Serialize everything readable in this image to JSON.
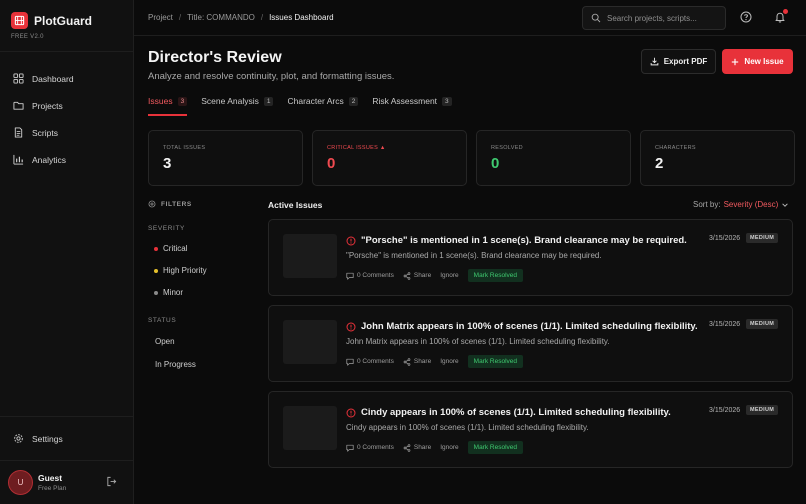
{
  "app": {
    "name": "PlotGuard",
    "version": "FREE V2.0"
  },
  "sidebar": {
    "items": [
      {
        "label": "Dashboard",
        "icon": "grid-icon"
      },
      {
        "label": "Projects",
        "icon": "folder-icon"
      },
      {
        "label": "Scripts",
        "icon": "file-icon"
      },
      {
        "label": "Analytics",
        "icon": "bar-chart-icon"
      }
    ],
    "settings_label": "Settings",
    "user": {
      "initial": "U",
      "name": "Guest",
      "plan": "Free Plan"
    }
  },
  "breadcrumb": [
    "Project",
    "Title: COMMANDO",
    "Issues Dashboard"
  ],
  "search": {
    "placeholder": "Search projects, scripts..."
  },
  "header": {
    "title": "Director's Review",
    "subtitle": "Analyze and resolve continuity, plot, and formatting issues.",
    "export_label": "Export PDF",
    "new_issue_label": "New Issue"
  },
  "tabs": [
    {
      "label": "Issues",
      "count": "3"
    },
    {
      "label": "Scene Analysis",
      "count": "1"
    },
    {
      "label": "Character Arcs",
      "count": "2"
    },
    {
      "label": "Risk Assessment",
      "count": "3"
    }
  ],
  "stats": [
    {
      "label": "TOTAL ISSUES",
      "value": "3",
      "color": "#f2f2f2"
    },
    {
      "label": "CRITICAL ISSUES ▲",
      "value": "0",
      "color": "#f04a50"
    },
    {
      "label": "RESOLVED",
      "value": "0",
      "color": "#3fca70"
    },
    {
      "label": "CHARACTERS",
      "value": "2",
      "color": "#f2f2f2"
    }
  ],
  "filters": {
    "title": "FILTERS",
    "severity_label": "SEVERITY",
    "severity": [
      {
        "label": "Critical",
        "color": "#e8323a"
      },
      {
        "label": "High Priority",
        "color": "#e6c02c"
      },
      {
        "label": "Minor",
        "color": "#8a8a8a"
      }
    ],
    "status_label": "STATUS",
    "status": [
      "Open",
      "In Progress"
    ]
  },
  "issues_section": {
    "title": "Active Issues",
    "sort_label": "Sort by:",
    "sort_value": "Severity (Desc)"
  },
  "issues": [
    {
      "title": "\"Porsche\" is mentioned in 1 scene(s). Brand clearance may be required.",
      "description": "\"Porsche\" is mentioned in 1 scene(s). Brand clearance may be required.",
      "date": "3/15/2026",
      "severity": "MEDIUM",
      "comments": "0 Comments",
      "share": "Share",
      "ignore": "Ignore",
      "resolve": "Mark Resolved"
    },
    {
      "title": "John Matrix appears in 100% of scenes (1/1). Limited scheduling flexibility.",
      "description": "John Matrix appears in 100% of scenes (1/1). Limited scheduling flexibility.",
      "date": "3/15/2026",
      "severity": "MEDIUM",
      "comments": "0 Comments",
      "share": "Share",
      "ignore": "Ignore",
      "resolve": "Mark Resolved"
    },
    {
      "title": "Cindy appears in 100% of scenes (1/1). Limited scheduling flexibility.",
      "description": "Cindy appears in 100% of scenes (1/1). Limited scheduling flexibility.",
      "date": "3/15/2026",
      "severity": "MEDIUM",
      "comments": "0 Comments",
      "share": "Share",
      "ignore": "Ignore",
      "resolve": "Mark Resolved"
    }
  ]
}
